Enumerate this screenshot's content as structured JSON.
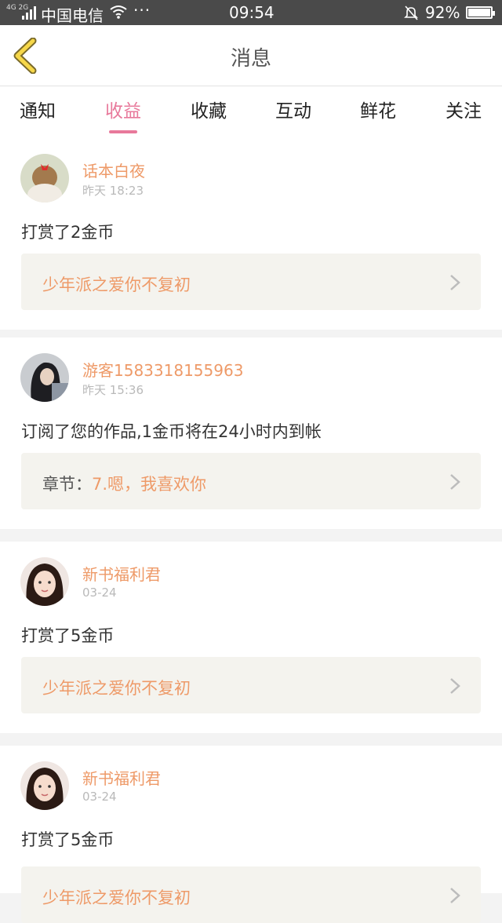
{
  "status_bar": {
    "network": "4G 2G",
    "carrier": "中国电信",
    "more": "···",
    "time": "09:54",
    "battery": "92%",
    "battery_level": 0.92
  },
  "header": {
    "title": "消息"
  },
  "tabs": [
    {
      "label": "通知",
      "active": false
    },
    {
      "label": "收益",
      "active": true
    },
    {
      "label": "收藏",
      "active": false
    },
    {
      "label": "互动",
      "active": false
    },
    {
      "label": "鲜花",
      "active": false
    },
    {
      "label": "关注",
      "active": false
    }
  ],
  "messages": [
    {
      "user": "话本白夜",
      "time": "昨天 18:23",
      "action": "打赏了2金币",
      "link_prefix": "",
      "link_text": "少年派之爱你不复初"
    },
    {
      "user": "游客1583318155963",
      "time": "昨天 15:36",
      "action": "订阅了您的作品,1金币将在24小时内到帐",
      "link_prefix": "章节：",
      "link_text": "7.嗯，我喜欢你"
    },
    {
      "user": "新书福利君",
      "time": "03-24",
      "action": "打赏了5金币",
      "link_prefix": "",
      "link_text": "少年派之爱你不复初"
    },
    {
      "user": "新书福利君",
      "time": "03-24",
      "action": "打赏了5金币",
      "link_prefix": "",
      "link_text": "少年派之爱你不复初"
    }
  ],
  "colors": {
    "accent": "#e8799b",
    "username": "#ee9a68",
    "back_arrow": "#f6d749"
  }
}
